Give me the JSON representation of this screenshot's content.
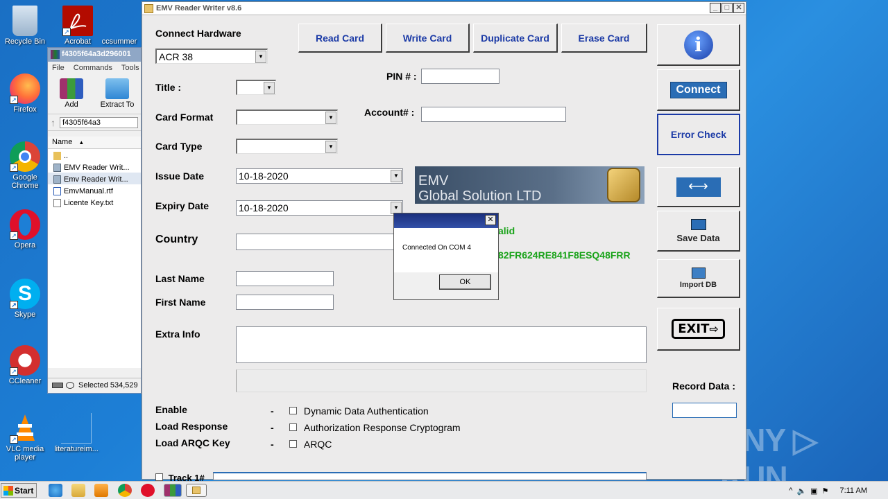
{
  "desktop": {
    "icons": [
      {
        "label": "Recycle Bin"
      },
      {
        "label": "Acrobat"
      },
      {
        "label": "ccsummer"
      },
      {
        "label": "Firefox"
      },
      {
        "label": "Google Chrome"
      },
      {
        "label": "Opera"
      },
      {
        "label": "Skype"
      },
      {
        "label": "CCleaner"
      },
      {
        "label": "VLC media player"
      },
      {
        "label": "literatureim..."
      }
    ],
    "watermark": "ANY ▷ RUN"
  },
  "rar": {
    "title": "f4305f64a3d296001",
    "menu": [
      "File",
      "Commands",
      "Tools"
    ],
    "tools": [
      "Add",
      "Extract To"
    ],
    "path": "f4305f64a3",
    "column": "Name",
    "files": [
      "..",
      "EMV Reader Writ...",
      "Emv Reader Writ...",
      "EmvManual.rtf",
      "Licente Key.txt"
    ],
    "status": "Selected 534,529"
  },
  "main": {
    "title": "EMV Reader Writer v8.6",
    "connect_hardware": "Connect Hardware",
    "hardware_value": "ACR 38",
    "buttons": {
      "read": "Read Card",
      "write": "Write Card",
      "duplicate": "Duplicate Card",
      "erase": "Erase Card"
    },
    "side": {
      "connect": "Connect",
      "error_check": "Error Check",
      "save_data": "Save Data",
      "import_db": "Import DB",
      "exit": "EXIT"
    },
    "labels": {
      "title": "Title :",
      "card_format": "Card Format",
      "card_type": "Card Type",
      "issue_date": "Issue Date",
      "expiry_date": "Expiry Date",
      "country": "Country",
      "last_name": "Last Name",
      "first_name": "First Name",
      "extra_info": "Extra Info",
      "pin": "PIN # :",
      "account": "Account# :",
      "record_data": "Record Data :",
      "enable": "Enable",
      "load_response": "Load Response",
      "load_arqc": "Load ARQC Key",
      "track1": "Track 1#"
    },
    "dates": {
      "issue": "10-18-2020",
      "expiry": "10-18-2020"
    },
    "banner": {
      "line1": "EMV",
      "line2": "Global Solution LTD"
    },
    "status_valid": "alid",
    "license_code": "82FR624RE841F8ESQ48FRR",
    "options": [
      {
        "dash": "-",
        "label": "Dynamic Data Authentication"
      },
      {
        "dash": "-",
        "label": "Authorization Response Cryptogram"
      },
      {
        "dash": "-",
        "label": "ARQC"
      }
    ]
  },
  "dialog": {
    "message": "Connected On COM 4",
    "ok": "OK"
  },
  "taskbar": {
    "start": "Start",
    "clock": "7:11 AM"
  },
  "colors": {
    "accent_blue": "#1b3aa6",
    "connect_bg": "#2a6db5",
    "status_green": "#1aa31a",
    "desktop": "#1d7fd6"
  }
}
